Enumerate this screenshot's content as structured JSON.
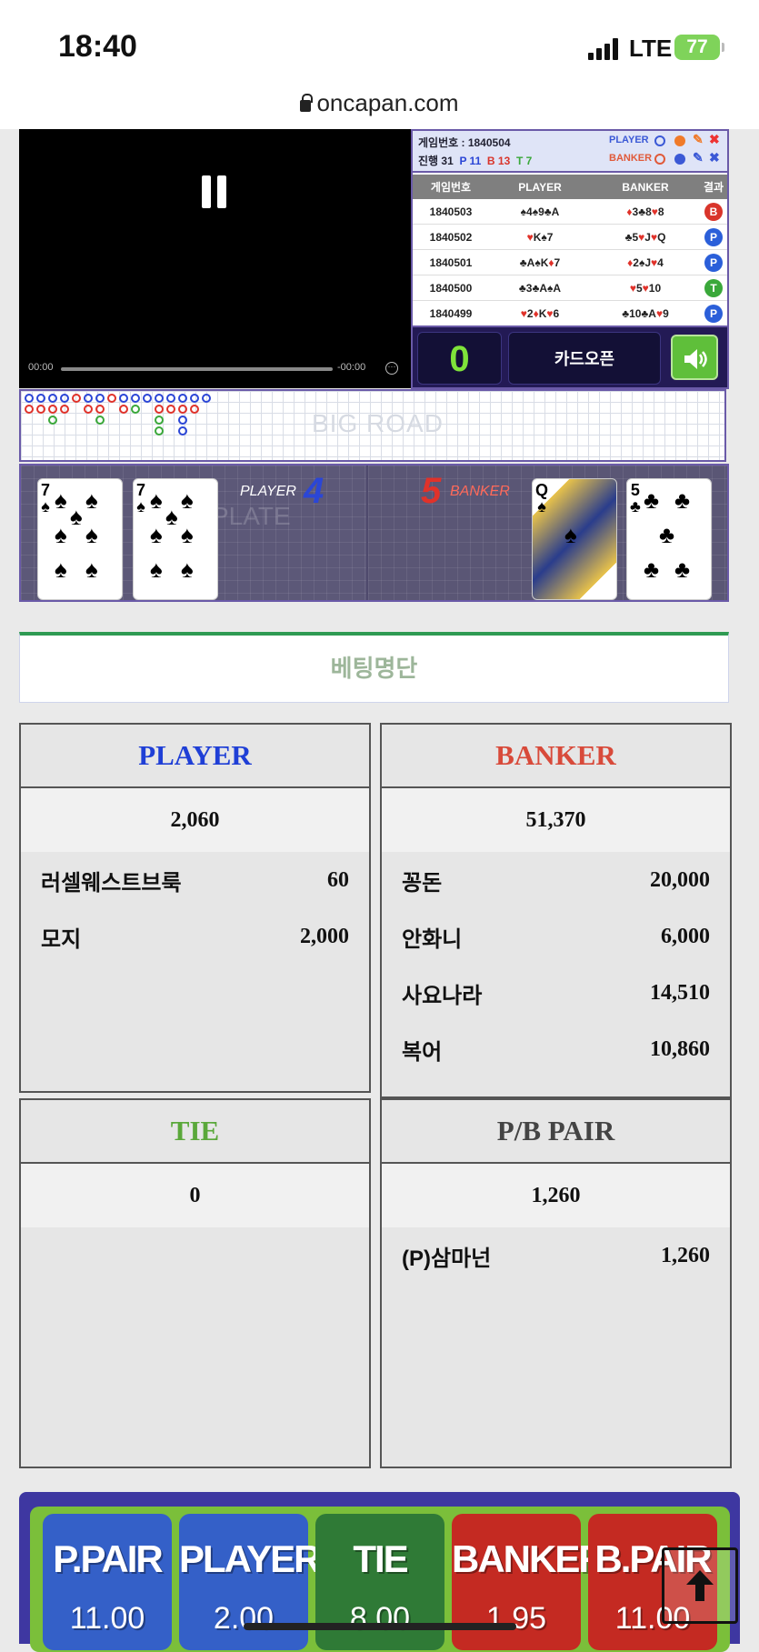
{
  "status_bar": {
    "time": "18:40",
    "network": "LTE",
    "battery": "77"
  },
  "browser": {
    "url": "oncapan.com"
  },
  "video": {
    "elapsed": "00:00",
    "remaining": "-00:00"
  },
  "game_info": {
    "game_number": "게임번호 : 1840504",
    "progress_label": "진행 31",
    "progress_p": "P 11",
    "progress_b": "B 13",
    "progress_t": "T 7",
    "player_label": "PLAYER",
    "banker_label": "BANKER"
  },
  "history": {
    "headers": [
      "게임번호",
      "PLAYER",
      "BANKER",
      "결과"
    ],
    "rows": [
      {
        "game": "1840503",
        "player": "♠4♠9♣A",
        "banker": "♦3♣8♥8",
        "result": "B",
        "result_color": "#d9352b"
      },
      {
        "game": "1840502",
        "player": "♥K♠7",
        "banker": "♣5♥J♥Q",
        "result": "P",
        "result_color": "#2b5fd9"
      },
      {
        "game": "1840501",
        "player": "♣A♠K♦7",
        "banker": "♦2♠J♥4",
        "result": "P",
        "result_color": "#2b5fd9"
      },
      {
        "game": "1840500",
        "player": "♣3♣A♠A",
        "banker": "♥5♥10",
        "result": "T",
        "result_color": "#3aa83a"
      },
      {
        "game": "1840499",
        "player": "♥2♦K♥6",
        "banker": "♣10♣A♥9",
        "result": "P",
        "result_color": "#2b5fd9"
      }
    ]
  },
  "controls": {
    "counter": "0",
    "card_open": "카드오픈"
  },
  "big_road_label": "BIG ROAD",
  "table": {
    "player_label": "PLAYER",
    "player_score": "4",
    "banker_label": "BANKER",
    "banker_score": "5",
    "player_cards": [
      {
        "rank": "7",
        "suit": "♠",
        "color": "#000"
      },
      {
        "rank": "7",
        "suit": "♠",
        "color": "#000"
      }
    ],
    "banker_cards": [
      {
        "rank": "Q",
        "suit": "♠",
        "color": "#000"
      },
      {
        "rank": "5",
        "suit": "♣",
        "color": "#000"
      }
    ],
    "watermark": "PLATE"
  },
  "bet_list_title": "베팅명단",
  "panels": {
    "player": {
      "title": "PLAYER",
      "color": "#1f3fd6",
      "total": "2,060",
      "rows": [
        {
          "name": "러셀웨스트브룩",
          "amount": "60"
        },
        {
          "name": "모지",
          "amount": "2,000"
        }
      ]
    },
    "banker": {
      "title": "BANKER",
      "color": "#d84a3a",
      "total": "51,370",
      "rows": [
        {
          "name": "꽁돈",
          "amount": "20,000"
        },
        {
          "name": "안화니",
          "amount": "6,000"
        },
        {
          "name": "사요나라",
          "amount": "14,510"
        },
        {
          "name": "복어",
          "amount": "10,860"
        }
      ]
    },
    "tie": {
      "title": "TIE",
      "color": "#5aa83a",
      "total": "0",
      "rows": []
    },
    "pair": {
      "title": "P/B PAIR",
      "color": "#444444",
      "total": "1,260",
      "rows": [
        {
          "name": "(P)삼마넌",
          "amount": "1,260"
        }
      ]
    }
  },
  "bet_buttons": [
    {
      "label": "P.PAIR",
      "odds": "11.00",
      "color": "#3460c8"
    },
    {
      "label": "PLAYER",
      "odds": "2.00",
      "color": "#3460c8"
    },
    {
      "label": "TIE",
      "odds": "8.00",
      "color": "#2f7a36"
    },
    {
      "label": "BANKER",
      "odds": "1.95",
      "color": "#c42a22"
    },
    {
      "label": "B.PAIR",
      "odds": "11.00",
      "color": "#c42a22"
    }
  ]
}
